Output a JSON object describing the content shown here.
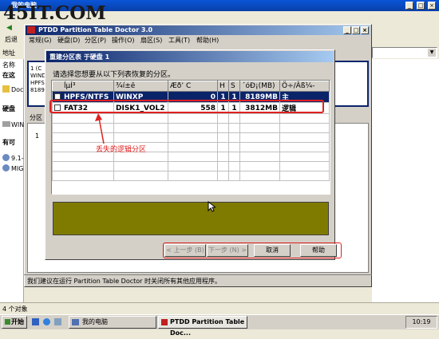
{
  "explorer": {
    "window_title": "我的电脑",
    "watermark": "45IT.COM",
    "back_label": "后退",
    "address_label": "地址",
    "sidebar_header": "名称",
    "sidebar_items": [
      "在这",
      "Doc",
      "硬盘",
      "WIN",
      "有可",
      "9.1-",
      "MIG"
    ],
    "status_left": "4 个对象"
  },
  "app": {
    "title": "PTDD Partition Table Doctor 3.0",
    "menu": [
      "常规(G)",
      "硬盘(D)",
      "分区(P)",
      "操作(O)",
      "扇区(S)",
      "工具(T)",
      "帮助(H)"
    ],
    "partition_tab": "分区",
    "bg_text_lines": [
      "1 (C",
      "WIND",
      "HPFS",
      "8189"
    ],
    "footer_note": "我们建议在运行 Partition Table Doctor 时关闭所有其他应用程序。",
    "row_num": "1"
  },
  "dialog": {
    "title": "重建分区表 于硬盘 1",
    "instruction": "请选择您想要从以下列表恢复的分区。",
    "columns": [
      "ĺµÍ³",
      "¾í±ê",
      "Æðʼ C",
      "H",
      "S",
      "´óÐ¡(MB)",
      "Ö÷/Âß¼-"
    ],
    "rows": [
      {
        "fs": "HPFS/NTFS",
        "label": "WINXP",
        "c": "0",
        "h": "1",
        "s": "1",
        "size": "8189MB",
        "type": "主",
        "selected": true
      },
      {
        "fs": "FAT32",
        "label": "DISK1_VOL2",
        "c": "558",
        "h": "1",
        "s": "1",
        "size": "3812MB",
        "type": "逻辑",
        "selected": false
      }
    ],
    "annotation": "丢失的逻辑分区",
    "buttons": {
      "prev": "< 上一步 (B)",
      "next": "下一步 (N) >",
      "cancel": "取消",
      "help": "帮助"
    },
    "colors": {
      "olive_panel": "#7f7a00",
      "annotation_red": "#e02020"
    }
  },
  "taskbar": {
    "start": "开始",
    "items": [
      "我的电脑",
      "PTDD Partition Table Doc..."
    ],
    "clock": "10:19"
  }
}
